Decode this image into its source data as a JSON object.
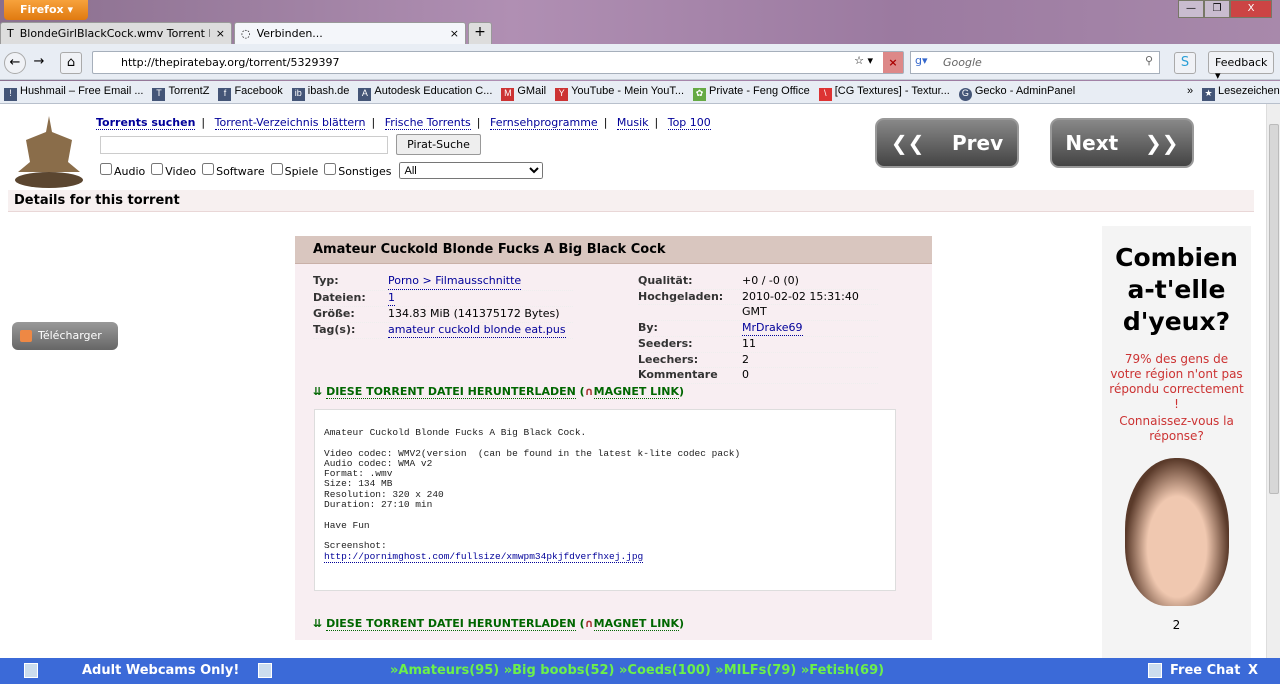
{
  "browser": {
    "menu_label": "Firefox",
    "tabs": [
      {
        "title": "BlondeGirlBlackCock.wmv Torrent D..."
      },
      {
        "title": "Verbinden..."
      }
    ],
    "url": "http://thepiratebay.org/torrent/5329397",
    "search_placeholder": "Google",
    "feedback_label": "Feedback",
    "bookmarks": [
      "Hushmail – Free Email ...",
      "TorrentZ",
      "Facebook",
      "ibash.de",
      "Autodesk Education C...",
      "GMail",
      "YouTube - Mein YouT...",
      "Private - Feng Office",
      "[CG Textures] - Textur...",
      "Gecko - AdminPanel"
    ],
    "bookmarks_more": "»",
    "bookmarks_menu": "Lesezeichen"
  },
  "site": {
    "nav": [
      "Torrents suchen",
      "Torrent-Verzeichnis blättern",
      "Frische Torrents",
      "Fernsehprogramme",
      "Musik",
      "Top 100"
    ],
    "search_button": "Pirat-Suche",
    "categories": [
      "Audio",
      "Video",
      "Software",
      "Spiele",
      "Sonstiges"
    ],
    "category_select": "All",
    "prev": "Prev",
    "next": "Next",
    "details_header": "Details for this torrent",
    "telecharger": "Télécharger"
  },
  "torrent": {
    "title": "Amateur Cuckold Blonde Fucks A Big Black Cock",
    "left": [
      {
        "k": "Typ:",
        "v": "Porno > Filmausschnitte",
        "link": true
      },
      {
        "k": "Dateien:",
        "v": "1",
        "link": true
      },
      {
        "k": "Größe:",
        "v": "134.83 MiB (141375172 Bytes)",
        "link": false
      },
      {
        "k": "Tag(s):",
        "v": "amateur cuckold blonde eat.pus",
        "link": true
      }
    ],
    "right": [
      {
        "k": "Qualität:",
        "v": "+0 / -0 (0)",
        "link": false
      },
      {
        "k": "Hochgeladen:",
        "v": "2010-02-02 15:31:40",
        "link": false
      },
      {
        "k": "",
        "v": "GMT",
        "link": false
      },
      {
        "k": "By:",
        "v": "MrDrake69",
        "link": true
      },
      {
        "k": "Seeders:",
        "v": "11",
        "link": false
      },
      {
        "k": "Leechers:",
        "v": "2",
        "link": false
      },
      {
        "k": "Kommentare",
        "v": "0",
        "link": false
      }
    ],
    "download_label": "DIESE TORRENT DATEI HERUNTERLADEN",
    "magnet_label": "MAGNET LINK",
    "description": "Amateur Cuckold Blonde Fucks A Big Black Cock.\n\nVideo codec: WMV2(version  (can be found in the latest k-lite codec pack)\nAudio codec: WMA v2\nFormat: .wmv\nSize: 134 MB\nResolution: 320 x 240\nDuration: 27:10 min\n\nHave Fun\n\nScreenshot:\n",
    "screenshot_link": "http://pornimghost.com/fullsize/xmwpm34pkjfdverfhxej.jpg"
  },
  "ad": {
    "headline": "Combien a-t'elle d'yeux?",
    "text1": "79% des gens de votre région n'ont pas répondu correctement !",
    "text2": "Connaissez-vous la réponse?",
    "number": "2"
  },
  "bottom_bar": {
    "left": "Adult Webcams Only!",
    "links": "»Amateurs(95) »Big boobs(52) »Coeds(100) »MILFs(79) »Fetish(69)",
    "chat": "Free Chat",
    "close": "X"
  }
}
